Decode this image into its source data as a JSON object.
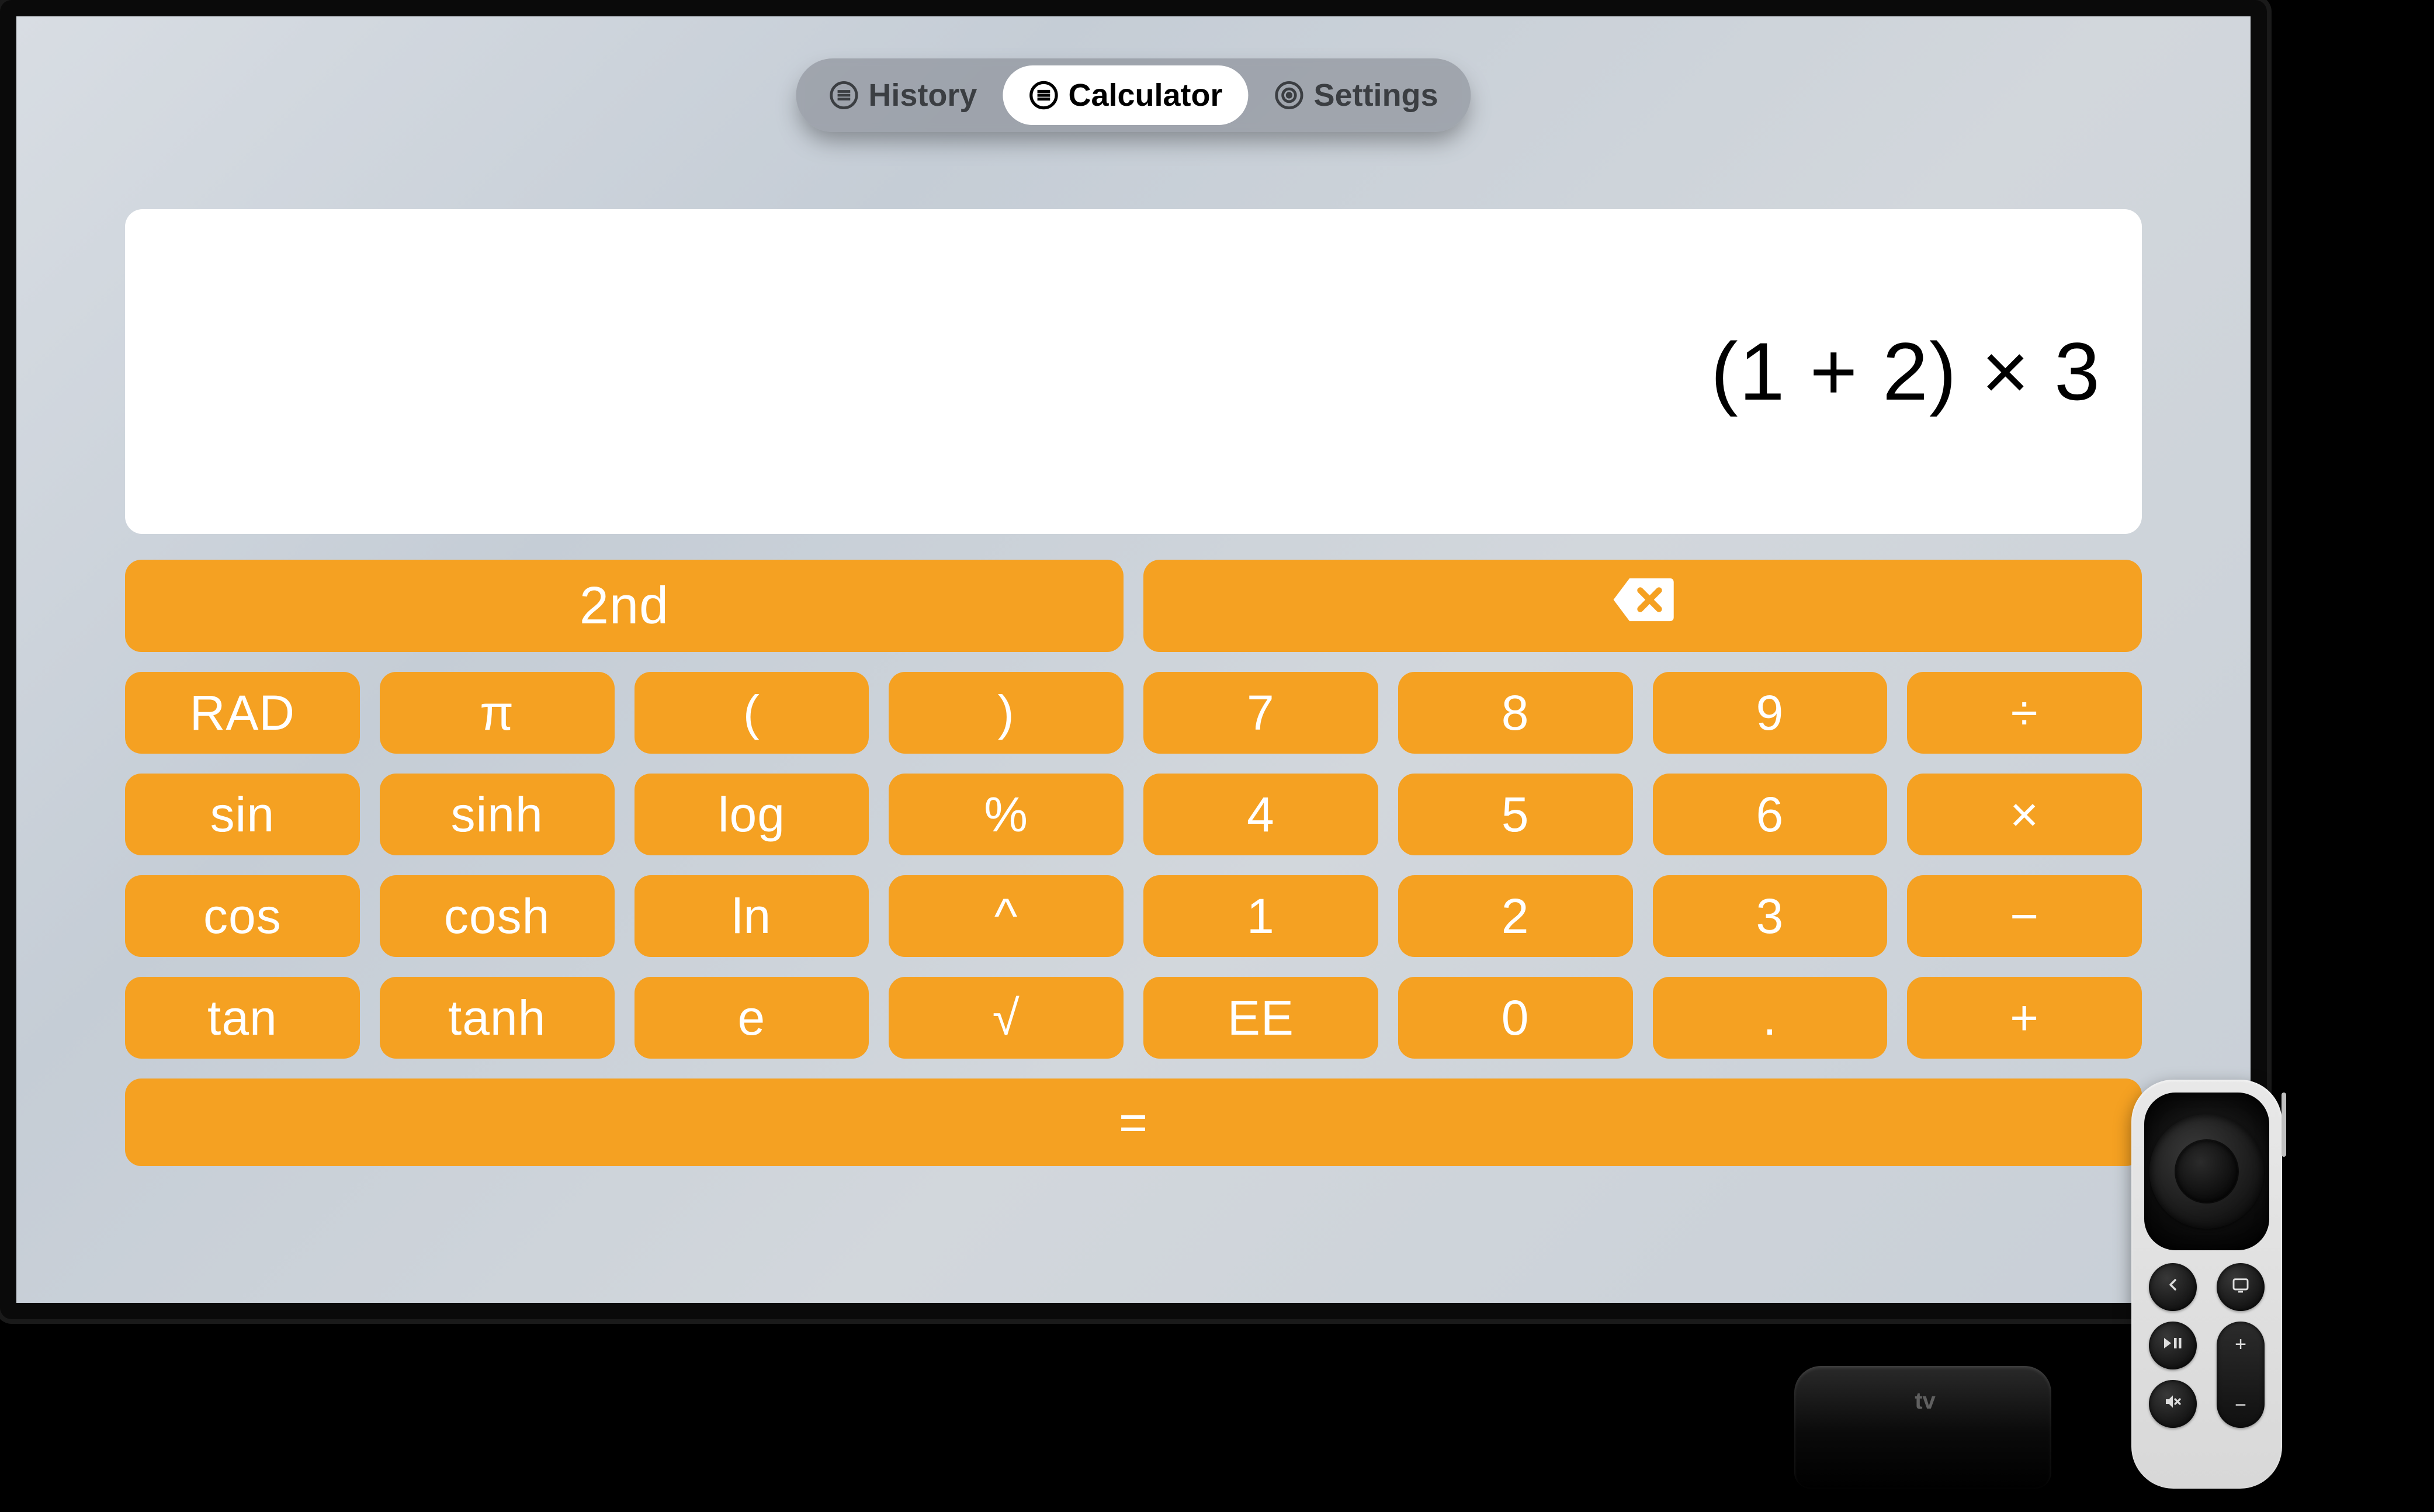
{
  "tabs": {
    "history": "History",
    "calculator": "Calculator",
    "settings": "Settings",
    "active": "calculator"
  },
  "display": {
    "expression": "(1 + 2) × 3"
  },
  "keys": {
    "second": "2nd",
    "rad": "RAD",
    "pi": "π",
    "open_paren": "(",
    "close_paren": ")",
    "sin": "sin",
    "sinh": "sinh",
    "log": "log",
    "percent": "%",
    "cos": "cos",
    "cosh": "cosh",
    "ln": "ln",
    "power": "^",
    "tan": "tan",
    "tanh": "tanh",
    "e": "e",
    "sqrt": "√",
    "seven": "7",
    "eight": "8",
    "nine": "9",
    "divide": "÷",
    "four": "4",
    "five": "5",
    "six": "6",
    "multiply": "×",
    "one": "1",
    "two": "2",
    "three": "3",
    "minus": "−",
    "ee": "EE",
    "zero": "0",
    "dot": ".",
    "plus": "+",
    "equals": "="
  },
  "device": {
    "box_label": "tv",
    "remote_plus": "+",
    "remote_minus": "−"
  },
  "colors": {
    "key_bg": "#f5a122",
    "key_fg": "#ffffff"
  }
}
